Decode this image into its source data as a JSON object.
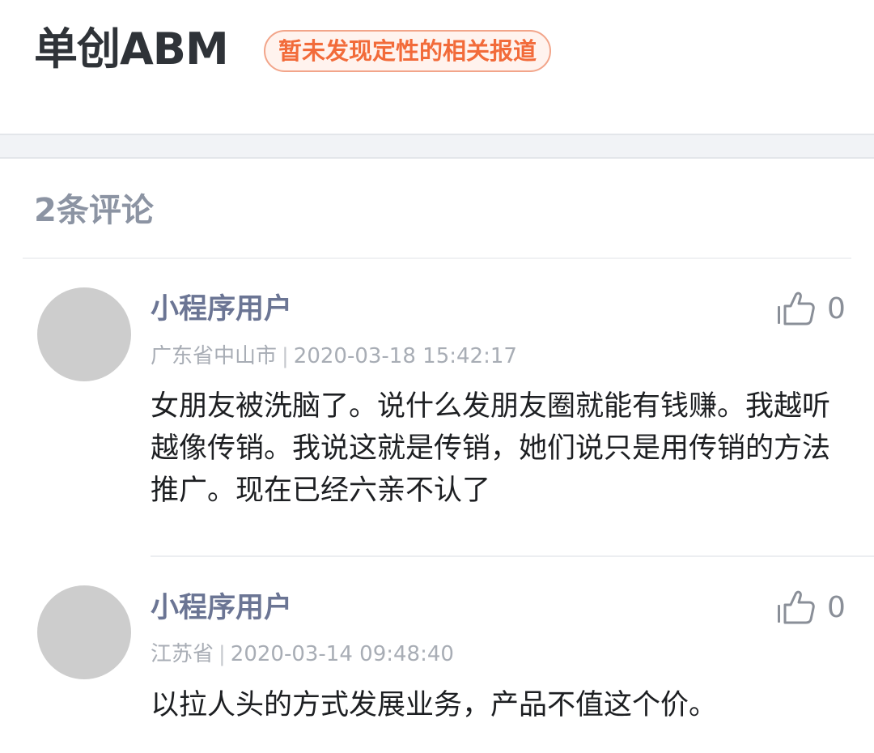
{
  "header": {
    "company_name": "单创ABM",
    "status_badge": "暂未发现定性的相关报道"
  },
  "comments_section": {
    "count_label": "2条评论",
    "comments": [
      {
        "username": "小程序用户",
        "location": "广东省中山市",
        "separator": "|",
        "timestamp": "2020-03-18 15:42:17",
        "text": "女朋友被洗脑了。说什么发朋友圈就能有钱赚。我越听越像传销。我说这就是传销，她们说只是用传销的方法推广。现在已经六亲不认了",
        "likes": "0",
        "like_icon": "thumbs-up-icon"
      },
      {
        "username": "小程序用户",
        "location": "江苏省",
        "separator": "|",
        "timestamp": "2020-03-14 09:48:40",
        "text": "以拉人头的方式发展业务，产品不值这个价。",
        "likes": "0",
        "like_icon": "thumbs-up-icon"
      }
    ]
  },
  "colors": {
    "badge_text": "#f26b3a",
    "badge_border": "#f2a58a",
    "username": "#6b7594",
    "avatar": "#cdcdcd"
  }
}
